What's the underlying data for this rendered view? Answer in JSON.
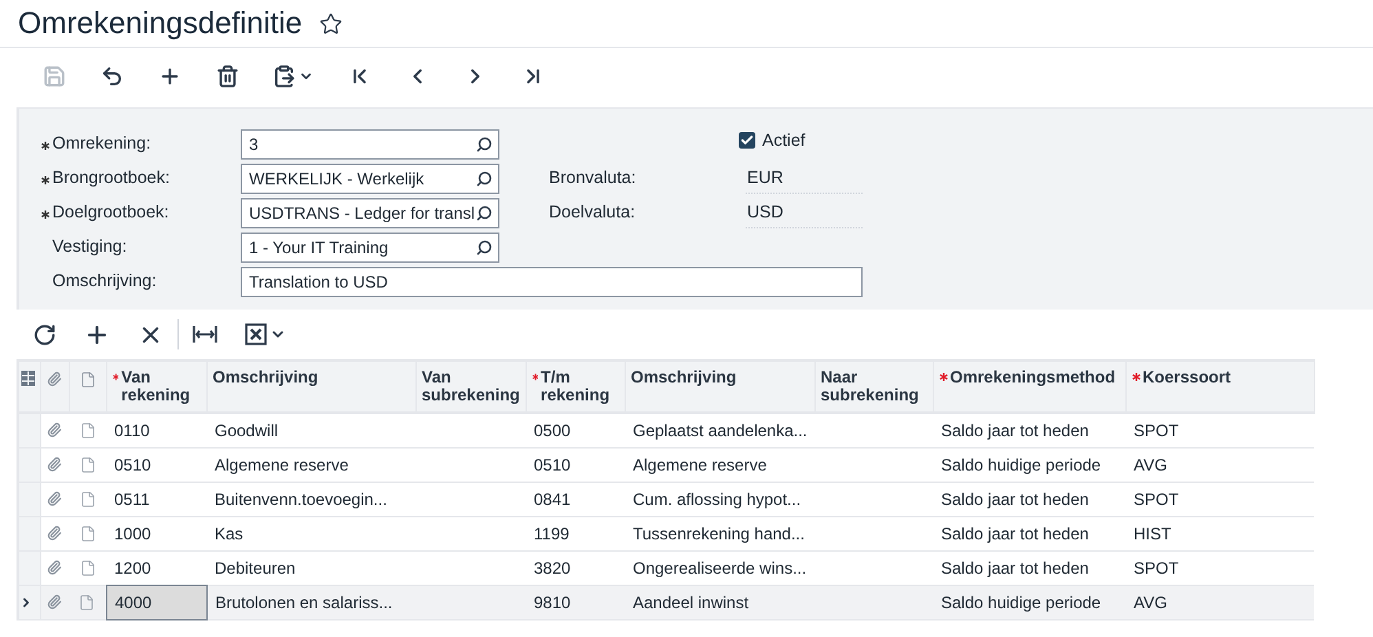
{
  "title": "Omrekeningsdefinitie",
  "favorite": false,
  "toolbar": [
    {
      "kind": "save",
      "disabled": true
    },
    {
      "kind": "undo",
      "disabled": false
    },
    {
      "kind": "add",
      "disabled": false
    },
    {
      "kind": "delete",
      "disabled": false
    },
    {
      "kind": "paste",
      "disabled": false
    },
    {
      "kind": "first",
      "disabled": false
    },
    {
      "kind": "prev",
      "disabled": false
    },
    {
      "kind": "next",
      "disabled": false
    },
    {
      "kind": "last",
      "disabled": false
    }
  ],
  "form": {
    "fields": [
      {
        "label": "Omrekening:",
        "value": "3",
        "required": true,
        "lookup": true
      },
      {
        "label": "Brongrootboek:",
        "value": "WERKELIJK - Werkelijk",
        "required": true,
        "lookup": true
      },
      {
        "label": "Doelgrootboek:",
        "value": "USDTRANS - Ledger for transl",
        "required": true,
        "lookup": true
      },
      {
        "label": "Vestiging:",
        "value": "1 - Your IT Training",
        "required": false,
        "lookup": true
      },
      {
        "label": "Omschrijving:",
        "value": "Translation to USD",
        "required": false,
        "lookup": false
      }
    ],
    "active": {
      "label": "Actief",
      "checked": true
    },
    "info": [
      {
        "label": "Bronvaluta:",
        "value": "EUR"
      },
      {
        "label": "Doelvaluta:",
        "value": "USD"
      }
    ]
  },
  "grid_toolbar": [
    {
      "kind": "refresh"
    },
    {
      "kind": "add"
    },
    {
      "kind": "remove"
    },
    {
      "kind": "fit"
    },
    {
      "kind": "export"
    }
  ],
  "table": {
    "columns": [
      {
        "label": "Van rekening",
        "required": true
      },
      {
        "label": "Omschrijving",
        "required": false
      },
      {
        "label": "Van subrekening",
        "required": false
      },
      {
        "label": "T/m rekening",
        "required": true
      },
      {
        "label": "Omschrijving",
        "required": false
      },
      {
        "label": "Naar subrekening",
        "required": false
      },
      {
        "label": "Omrekeningsmethod",
        "required": true
      },
      {
        "label": "Koerssoort",
        "required": true
      }
    ],
    "rows": [
      {
        "selected": false,
        "cells": [
          "0110",
          "Goodwill",
          "",
          "0500",
          "Geplaatst aandelenka...",
          "",
          "Saldo jaar tot heden",
          "SPOT"
        ]
      },
      {
        "selected": false,
        "cells": [
          "0510",
          "Algemene reserve",
          "",
          "0510",
          "Algemene reserve",
          "",
          "Saldo huidige periode",
          "AVG"
        ]
      },
      {
        "selected": false,
        "cells": [
          "0511",
          "Buitenvenn.toevoegin...",
          "",
          "0841",
          "Cum. aflossing hypot...",
          "",
          "Saldo jaar tot heden",
          "SPOT"
        ]
      },
      {
        "selected": false,
        "cells": [
          "1000",
          "Kas",
          "",
          "1199",
          "Tussenrekening hand...",
          "",
          "Saldo jaar tot heden",
          "HIST"
        ]
      },
      {
        "selected": false,
        "cells": [
          "1200",
          "Debiteuren",
          "",
          "3820",
          "Ongerealiseerde wins...",
          "",
          "Saldo jaar tot heden",
          "SPOT"
        ]
      },
      {
        "selected": true,
        "cells": [
          "4000",
          "Brutolonen en salariss...",
          "",
          "9810",
          "Aandeel inwinst",
          "",
          "Saldo huidige periode",
          "AVG"
        ]
      }
    ]
  }
}
